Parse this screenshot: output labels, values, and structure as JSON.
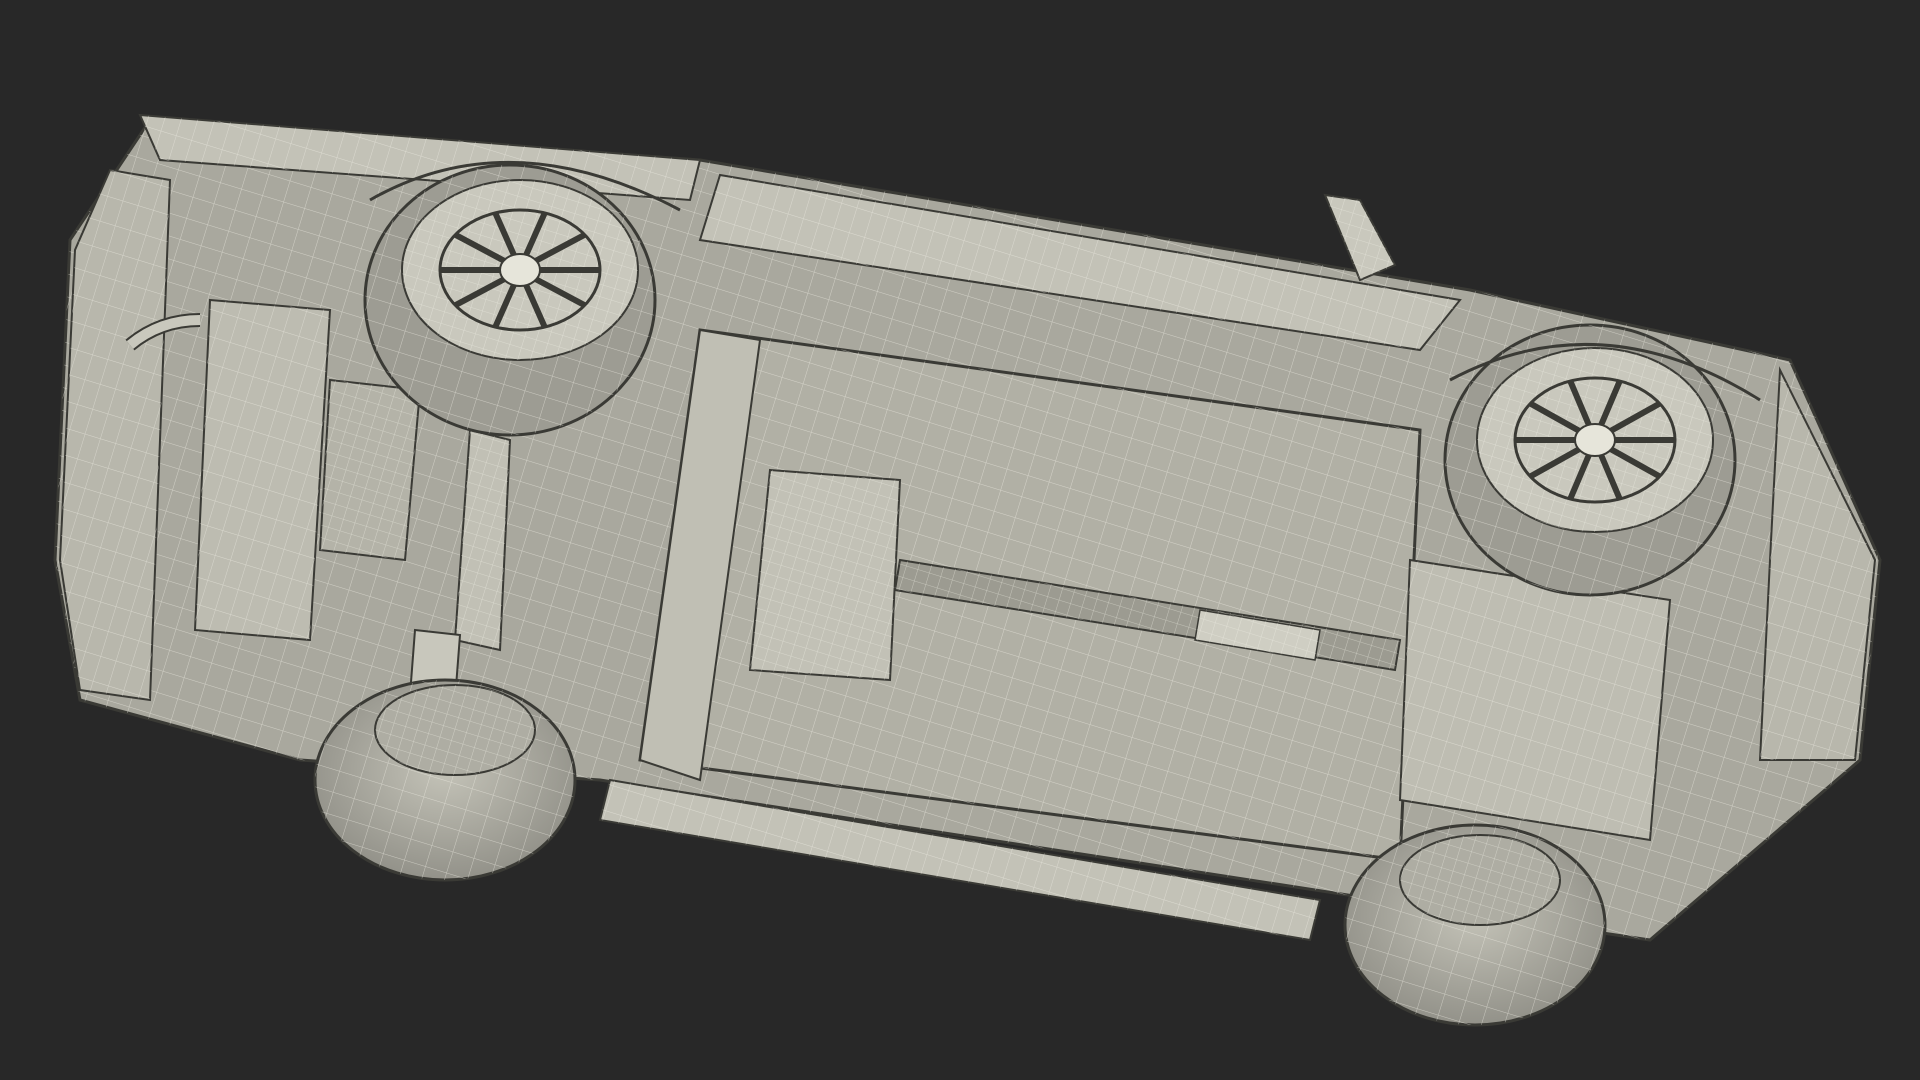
{
  "scene": {
    "subject": "car-underside-wireframe",
    "colors": {
      "background": "#282828",
      "panel": "#b9b8ad",
      "panel_dark": "#8f8e85",
      "panel_shadow": "#6f6e66",
      "wire": "#f2f1e8",
      "edge": "#3a3a35"
    }
  }
}
